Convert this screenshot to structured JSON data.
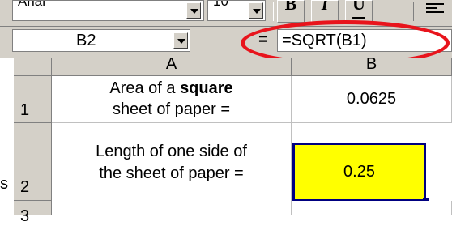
{
  "toolbar": {
    "font_name": "Arial",
    "font_size": "10",
    "bold_label": "B",
    "italic_label": "I",
    "underline_label": "U",
    "align_icon": "align-left-icon"
  },
  "formula_bar": {
    "name_box": "B2",
    "equals_label": "=",
    "formula": "=SQRT(B1)",
    "highlight_color": "#e8141c"
  },
  "grid": {
    "columns": [
      "A",
      "B"
    ],
    "rows": [
      {
        "header": "1",
        "a_line1_pre": "Area of a ",
        "a_line1_bold": "square",
        "a_line2": "sheet of paper =",
        "b": "0.0625"
      },
      {
        "header": "2",
        "a_line1": "Length of one side of",
        "a_line2": "the sheet of paper =",
        "b": "0.25"
      },
      {
        "header": "3"
      }
    ],
    "selected_fill": "#ffff00",
    "selection_border": "#000080",
    "stray_char": "s"
  }
}
